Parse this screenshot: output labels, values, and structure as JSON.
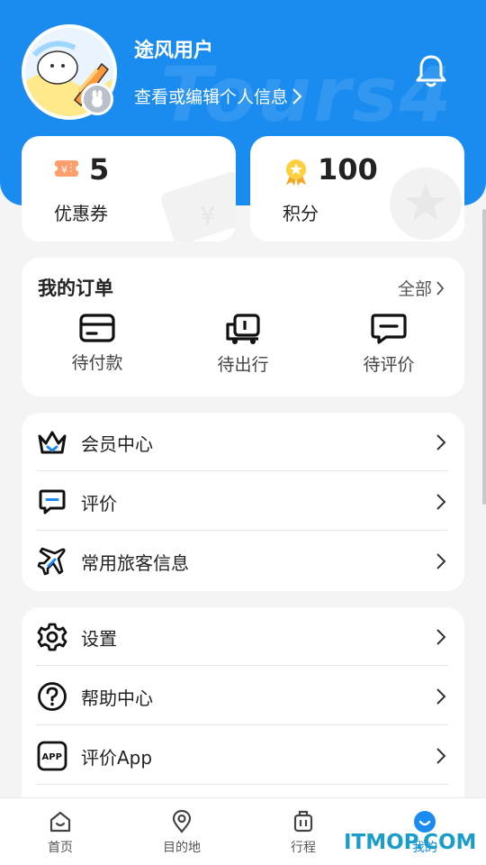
{
  "profile": {
    "username": "途风用户",
    "edit_link": "查看或编辑个人信息"
  },
  "header": {
    "watermark": "Tours4"
  },
  "stats": [
    {
      "value": "5",
      "label": "优惠券",
      "icon": "coupon-icon"
    },
    {
      "value": "100",
      "label": "积分",
      "icon": "points-medal-icon"
    }
  ],
  "orders": {
    "title": "我的订单",
    "all_label": "全部",
    "items": [
      {
        "label": "待付款",
        "icon": "card-payment-icon"
      },
      {
        "label": "待出行",
        "icon": "luggage-cart-icon"
      },
      {
        "label": "待评价",
        "icon": "comment-icon"
      }
    ]
  },
  "menu_group_1": [
    {
      "label": "会员中心",
      "icon": "crown-icon"
    },
    {
      "label": "评价",
      "icon": "comment-icon"
    },
    {
      "label": "常用旅客信息",
      "icon": "airplane-icon"
    }
  ],
  "menu_group_2": [
    {
      "label": "设置",
      "icon": "gear-icon"
    },
    {
      "label": "帮助中心",
      "icon": "question-icon"
    },
    {
      "label": "评价App",
      "icon": "app-icon"
    }
  ],
  "tabbar": [
    {
      "label": "首页",
      "icon": "home-icon",
      "active": false
    },
    {
      "label": "目的地",
      "icon": "location-pin-icon",
      "active": false
    },
    {
      "label": "行程",
      "icon": "suitcase-icon",
      "active": false
    },
    {
      "label": "我的",
      "icon": "smile-icon",
      "active": true
    }
  ],
  "overlay_watermark": "ITMOP.COM",
  "colors": {
    "primary": "#1a8cef",
    "background": "#f4f4f4",
    "card": "#ffffff"
  }
}
